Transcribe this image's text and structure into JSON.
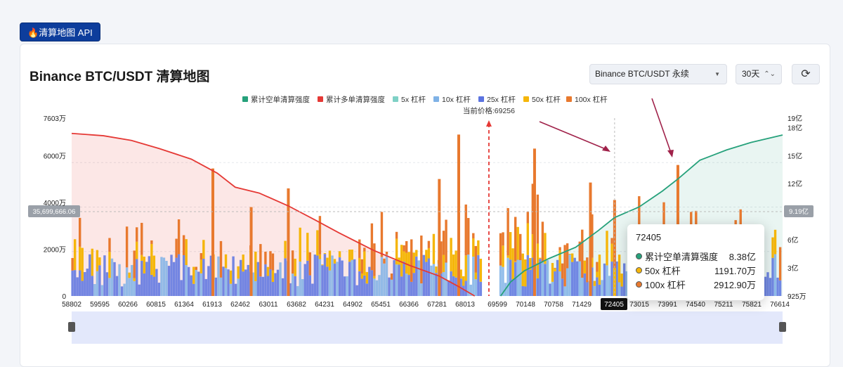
{
  "api_tag": {
    "icon": "fire-icon",
    "icon_char": "🔥",
    "label": "清算地图 API"
  },
  "header": {
    "title": "Binance BTC/USDT 清算地图"
  },
  "controls": {
    "market_select": "Binance BTC/USDT 永续",
    "period_select": "30天",
    "refresh_icon": "refresh-icon",
    "refresh_char": "⟳"
  },
  "current_price_label": "当前价格:69256",
  "left_axis_current": "35,699,666.06",
  "right_axis_current": "9.19亿",
  "x_highlight_label": "72405",
  "tooltip": {
    "title": "72405",
    "rows": [
      {
        "label": "累计空单清算强度",
        "value": "8.38亿",
        "color": "#26a17b"
      },
      {
        "label": "50x 杠杆",
        "value": "1191.70万",
        "color": "#f5b60a"
      },
      {
        "label": "100x 杠杆",
        "value": "2912.90万",
        "color": "#e8792e"
      }
    ]
  },
  "colors": {
    "short_cum": "#26a17b",
    "long_cum": "#e53935",
    "x5": "#7fd1c6",
    "x10": "#7fb2e6",
    "x25": "#5b73e0",
    "x50": "#f5b60a",
    "x100": "#e8792e"
  },
  "chart_data": {
    "type": "bar",
    "legend": [
      "累计空单清算强度",
      "累计多单清算强度",
      "5x 杠杆",
      "10x 杠杆",
      "25x 杠杆",
      "50x 杠杆",
      "100x 杠杆"
    ],
    "x_ticks": [
      "58802",
      "59595",
      "60266",
      "60815",
      "61364",
      "61913",
      "62462",
      "63011",
      "63682",
      "64231",
      "64902",
      "65451",
      "66366",
      "67281",
      "68013",
      "69599",
      "70148",
      "70758",
      "71429",
      "72405",
      "73015",
      "73991",
      "74540",
      "75211",
      "75821",
      "76614"
    ],
    "x_range": [
      58802,
      76614
    ],
    "current_price": 69256,
    "y_left_ticks": [
      "0",
      "2000万",
      "4000万",
      "6000万",
      "7603万"
    ],
    "y_left_range": [
      0,
      76030000
    ],
    "y_right_ticks": [
      "925万",
      "3亿",
      "6亿",
      "9亿",
      "12亿",
      "15亿",
      "18亿",
      "19亿"
    ],
    "y_right_range": [
      0,
      1900000000
    ],
    "highlight": {
      "x": 72405,
      "short_cum": "8.38亿",
      "x50": "1191.70万",
      "x100": "2912.90万"
    },
    "long_cum_curve": [
      [
        58802,
        69500000
      ],
      [
        59600,
        68500000
      ],
      [
        60300,
        66500000
      ],
      [
        61000,
        63000000
      ],
      [
        61800,
        58500000
      ],
      [
        62450,
        52500000
      ],
      [
        62900,
        46500000
      ],
      [
        63500,
        44000000
      ],
      [
        64231,
        38500000
      ],
      [
        64900,
        32500000
      ],
      [
        65500,
        27000000
      ],
      [
        66366,
        19500000
      ],
      [
        67281,
        13000000
      ],
      [
        68013,
        8500000
      ],
      [
        68500,
        4000000
      ],
      [
        68900,
        0
      ]
    ],
    "short_cum_curve": [
      [
        69550,
        0
      ],
      [
        69800,
        150000000
      ],
      [
        70148,
        270000000
      ],
      [
        70758,
        400000000
      ],
      [
        71429,
        520000000
      ],
      [
        72000,
        700000000
      ],
      [
        72405,
        838000000
      ],
      [
        73015,
        950000000
      ],
      [
        73600,
        1120000000
      ],
      [
        73991,
        1250000000
      ],
      [
        74540,
        1450000000
      ],
      [
        75211,
        1560000000
      ],
      [
        75821,
        1640000000
      ],
      [
        76614,
        1720000000
      ]
    ],
    "bars_sampled": [
      {
        "x": 62340,
        "x100": 54500000
      },
      {
        "x": 63300,
        "x100": 38000000
      },
      {
        "x": 64231,
        "x100": 46000000
      },
      {
        "x": 68013,
        "x100": 50000000
      },
      {
        "x": 68500,
        "x100": 69000000
      },
      {
        "x": 70400,
        "x100": 63000000
      },
      {
        "x": 71800,
        "x100": 48500000
      },
      {
        "x": 72405,
        "x50": 11917000,
        "x100": 29129000,
        "note_total": 61000000
      },
      {
        "x": 73991,
        "x100": 56000000
      }
    ]
  }
}
